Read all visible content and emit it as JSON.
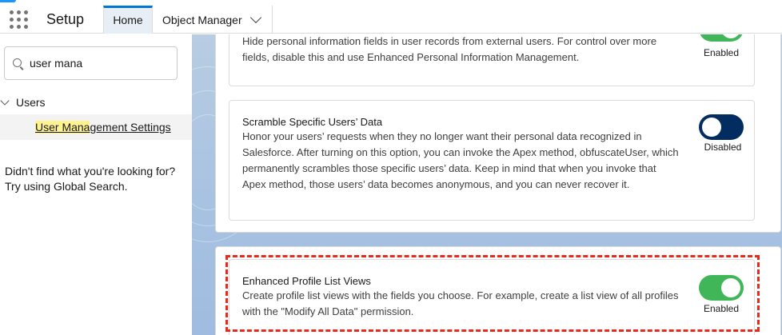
{
  "header": {
    "app_title": "Setup",
    "tabs": [
      {
        "label": "Home",
        "active": true
      },
      {
        "label": "Object Manager",
        "active": false
      }
    ],
    "accent_color": "#0176d3"
  },
  "sidebar": {
    "search": {
      "value": "user mana",
      "icon": "search-icon"
    },
    "tree": {
      "group_label": "Users",
      "item_prefix_highlight": "User Mana",
      "item_suffix": "gement Settings"
    },
    "not_found_line1": "Didn't find what you're looking for?",
    "not_found_line2": "Try using Global Search."
  },
  "settings": [
    {
      "title": "",
      "description": "Hide personal information fields in user records from external users. For control over more fields, disable this and use Enhanced Personal Information Management.",
      "status": "Enabled",
      "enabled": true
    },
    {
      "title": "Scramble Specific Users’ Data",
      "description": "Honor your users’ requests when they no longer want their personal data recognized in Salesforce. After turning on this option, you can invoke the Apex method, obfuscateUser, which permanently scrambles those specific users’ data. Keep in mind that when you invoke that Apex method, those users’ data becomes anonymous, and you can never recover it.",
      "status": "Disabled",
      "enabled": false
    },
    {
      "title": "Enhanced Profile List Views",
      "description": "Create profile list views with the fields you choose. For example, create a list view of all profiles with the \"Modify All Data\" permission.",
      "status": "Enabled",
      "enabled": true
    }
  ],
  "colors": {
    "toggle_on": "#41b658",
    "toggle_off": "#032d60",
    "highlight_border": "#e8291c"
  }
}
